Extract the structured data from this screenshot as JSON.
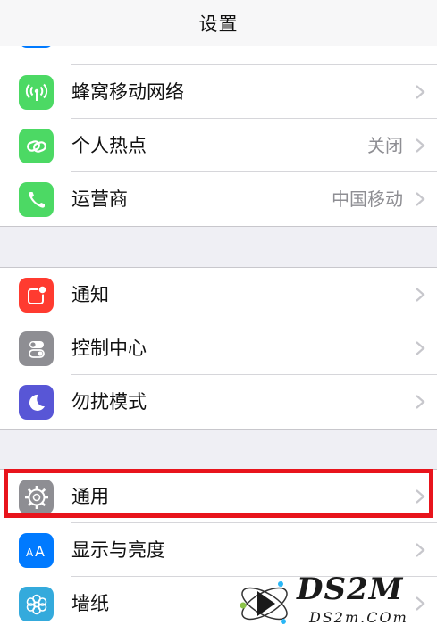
{
  "navbar": {
    "title": "设置"
  },
  "group1": {
    "items": [
      {
        "label": "蜂窝移动网络",
        "value": "",
        "icon": "antenna-icon",
        "color": "#4cd964"
      },
      {
        "label": "个人热点",
        "value": "关闭",
        "icon": "hotspot-chain-icon",
        "color": "#4cd964"
      },
      {
        "label": "运营商",
        "value": "中国移动",
        "icon": "phone-icon",
        "color": "#4cd964"
      }
    ]
  },
  "group2": {
    "items": [
      {
        "label": "通知",
        "value": "",
        "icon": "notification-icon",
        "color": "#ff3b30"
      },
      {
        "label": "控制中心",
        "value": "",
        "icon": "control-center-icon",
        "color": "#8e8e93"
      },
      {
        "label": "勿扰模式",
        "value": "",
        "icon": "moon-icon",
        "color": "#5856d6"
      }
    ]
  },
  "group3": {
    "items": [
      {
        "label": "通用",
        "value": "",
        "icon": "gear-icon",
        "color": "#8e8e93"
      },
      {
        "label": "显示与亮度",
        "value": "",
        "icon": "display-aa-icon",
        "color": "#007aff"
      },
      {
        "label": "墙纸",
        "value": "",
        "icon": "wallpaper-flower-icon",
        "color": "#34aadc"
      }
    ]
  },
  "watermark": {
    "logo_text": "DS2M",
    "url_text": "DS2m.COm"
  }
}
